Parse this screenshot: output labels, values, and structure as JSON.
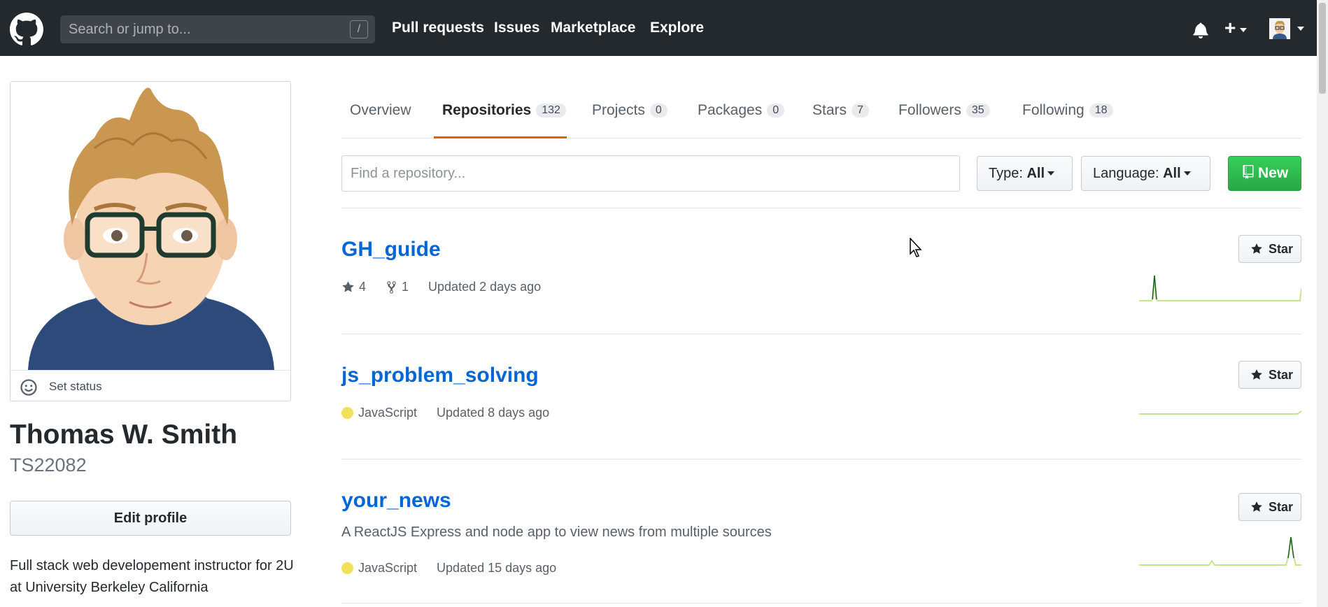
{
  "header": {
    "logo_icon": "github-mark-icon",
    "search_placeholder": "Search or jump to...",
    "search_shortcut": "/",
    "nav": [
      "Pull requests",
      "Issues",
      "Marketplace",
      "Explore"
    ]
  },
  "profile": {
    "set_status": "Set status",
    "full_name": "Thomas W. Smith",
    "username": "TS22082",
    "edit_profile": "Edit profile",
    "bio": "Full stack web developement instructor for 2U at University Berkeley California"
  },
  "tabs": [
    {
      "label": "Overview",
      "count": null,
      "selected": false
    },
    {
      "label": "Repositories",
      "count": "132",
      "selected": true
    },
    {
      "label": "Projects",
      "count": "0",
      "selected": false
    },
    {
      "label": "Packages",
      "count": "0",
      "selected": false
    },
    {
      "label": "Stars",
      "count": "7",
      "selected": false
    },
    {
      "label": "Followers",
      "count": "35",
      "selected": false
    },
    {
      "label": "Following",
      "count": "18",
      "selected": false
    }
  ],
  "filters": {
    "find_placeholder": "Find a repository...",
    "type_label": "Type:",
    "type_value": "All",
    "language_label": "Language:",
    "language_value": "All",
    "new_label": "New"
  },
  "repos": [
    {
      "name": "GH_guide",
      "description": "",
      "language": "",
      "stars": "4",
      "forks": "1",
      "updated": "Updated 2 days ago",
      "star_label": "Star"
    },
    {
      "name": "js_problem_solving",
      "description": "",
      "language": "JavaScript",
      "stars": "",
      "forks": "",
      "updated": "Updated 8 days ago",
      "star_label": "Star"
    },
    {
      "name": "your_news",
      "description": "A ReactJS Express and node app to view news from multiple sources",
      "language": "JavaScript",
      "stars": "",
      "forks": "",
      "updated": "Updated 15 days ago",
      "star_label": "Star"
    }
  ],
  "colors": {
    "header_bg": "#24292e",
    "link": "#0366d6",
    "tab_underline": "#e36209",
    "new_button": "#28a745",
    "javascript": "#f1e05a"
  }
}
